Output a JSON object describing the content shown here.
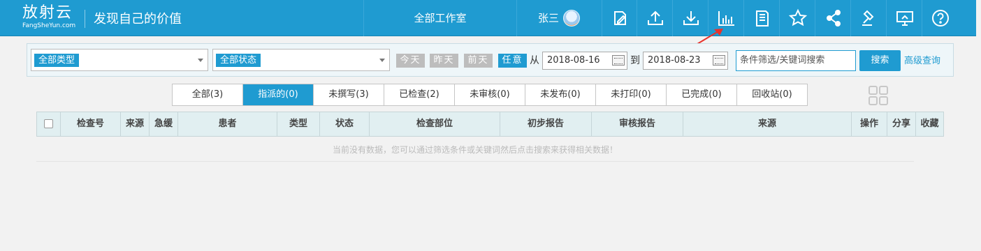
{
  "header": {
    "logo_main": "放射云",
    "logo_sub": "FangSheYun.com",
    "slogan": "发现自己的价值",
    "workroom": "全部工作室",
    "user_name": "张三",
    "toolbar_icons": [
      "edit-icon",
      "upload-icon",
      "download-icon",
      "bar-chart-icon",
      "book-icon",
      "star-icon",
      "share-icon",
      "gavel-icon",
      "monitor-icon",
      "help-icon"
    ]
  },
  "filters": {
    "type_select": "全部类型",
    "status_select": "全部状态",
    "quick_days": [
      "今天",
      "昨天",
      "前天",
      "任意"
    ],
    "active_day": "任意",
    "from_label": "从",
    "from_date": "2018-08-16",
    "to_label": "到",
    "to_date": "2018-08-23",
    "search_placeholder": "条件筛选/关键词搜索",
    "search_button": "搜索",
    "advanced_link": "高级查询"
  },
  "tabs": [
    "全部(3)",
    "指派的(0)",
    "未撰写(3)",
    "已检查(2)",
    "未审核(0)",
    "未发布(0)",
    "未打印(0)",
    "已完成(0)",
    "回收站(0)"
  ],
  "active_tab": "指派的(0)",
  "table": {
    "columns": [
      "检查号",
      "来源",
      "急缓",
      "患者",
      "类型",
      "状态",
      "检查部位",
      "初步报告",
      "审核报告",
      "来源",
      "操作",
      "分享",
      "收藏"
    ],
    "empty_message": "当前没有数据，您可以通过筛选条件或关键词然后点击搜索来获得相关数据！"
  },
  "colors": {
    "header_bg": "#1f9bd1",
    "accent": "#1f9bd1",
    "annotation_arrow": "#e8332d"
  }
}
